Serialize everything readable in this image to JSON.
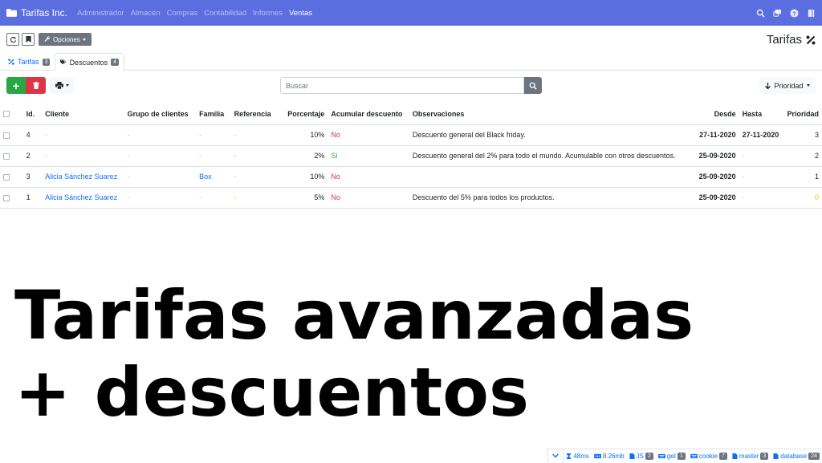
{
  "navbar": {
    "brand": "Tarifas Inc.",
    "menu": [
      "Administrador",
      "Almacén",
      "Compras",
      "Contabilidad",
      "Informes",
      "Ventas"
    ],
    "active": "Ventas",
    "icons": [
      "search-icon",
      "messages-icon",
      "help-icon",
      "logout-icon"
    ]
  },
  "toolbar": {
    "options_label": "Opciones"
  },
  "page_title": "Tarifas",
  "tabs": [
    {
      "label": "Tarifas",
      "count": "3"
    },
    {
      "label": "Descuentos",
      "count": "4"
    }
  ],
  "actions": {
    "add_label": "+",
    "search_placeholder": "Buscar",
    "sort_label": "Prioridad"
  },
  "table": {
    "headers": [
      "Id.",
      "Cliente",
      "Grupo de clientes",
      "Familia",
      "Referencia",
      "Porcentaje",
      "Acumular descuento",
      "Observaciones",
      "Desde",
      "Hasta",
      "Prioridad"
    ],
    "rows": [
      {
        "id": "4",
        "cliente": "-",
        "grupo": "-",
        "familia": "-",
        "referencia": "-",
        "porcentaje": "10%",
        "acumular": "No",
        "observaciones": "Descuento general del Black friday.",
        "desde": "27-11-2020",
        "hasta": "27-11-2020",
        "prioridad": "3"
      },
      {
        "id": "2",
        "cliente": "-",
        "grupo": "-",
        "familia": "-",
        "referencia": "-",
        "porcentaje": "2%",
        "acumular": "Si",
        "observaciones": "Descuento general del 2% para todo el mundo. Acumulable con otros descuentos.",
        "desde": "25-09-2020",
        "hasta": "-",
        "prioridad": "2"
      },
      {
        "id": "3",
        "cliente": "Alicia Sánchez Suarez",
        "grupo": "-",
        "familia": "Box",
        "referencia": "-",
        "porcentaje": "10%",
        "acumular": "No",
        "observaciones": "",
        "desde": "25-09-2020",
        "hasta": "-",
        "prioridad": "1"
      },
      {
        "id": "1",
        "cliente": "Alicia Sánchez Suarez",
        "grupo": "-",
        "familia": "-",
        "referencia": "-",
        "porcentaje": "5%",
        "acumular": "No",
        "observaciones": "Descuento del 5% para todos los productos.",
        "desde": "25-09-2020",
        "hasta": "-",
        "prioridad": "0"
      }
    ]
  },
  "overlay": {
    "line1": "Tarifas avanzadas",
    "line2": "+ descuentos"
  },
  "debugbar": {
    "time": "48ms",
    "memory": "8.26mb",
    "items": [
      {
        "label": "JS",
        "count": "2"
      },
      {
        "label": "get",
        "count": "1"
      },
      {
        "label": "cookie",
        "count": "7"
      },
      {
        "label": "master",
        "count": "3"
      },
      {
        "label": "database",
        "count": "24"
      }
    ]
  },
  "colors": {
    "navbar": "#5b6ee0",
    "success": "#28a745",
    "danger": "#dc3545",
    "link": "#0d6efd",
    "warning": "#ffc107",
    "secondary": "#6c757d"
  }
}
